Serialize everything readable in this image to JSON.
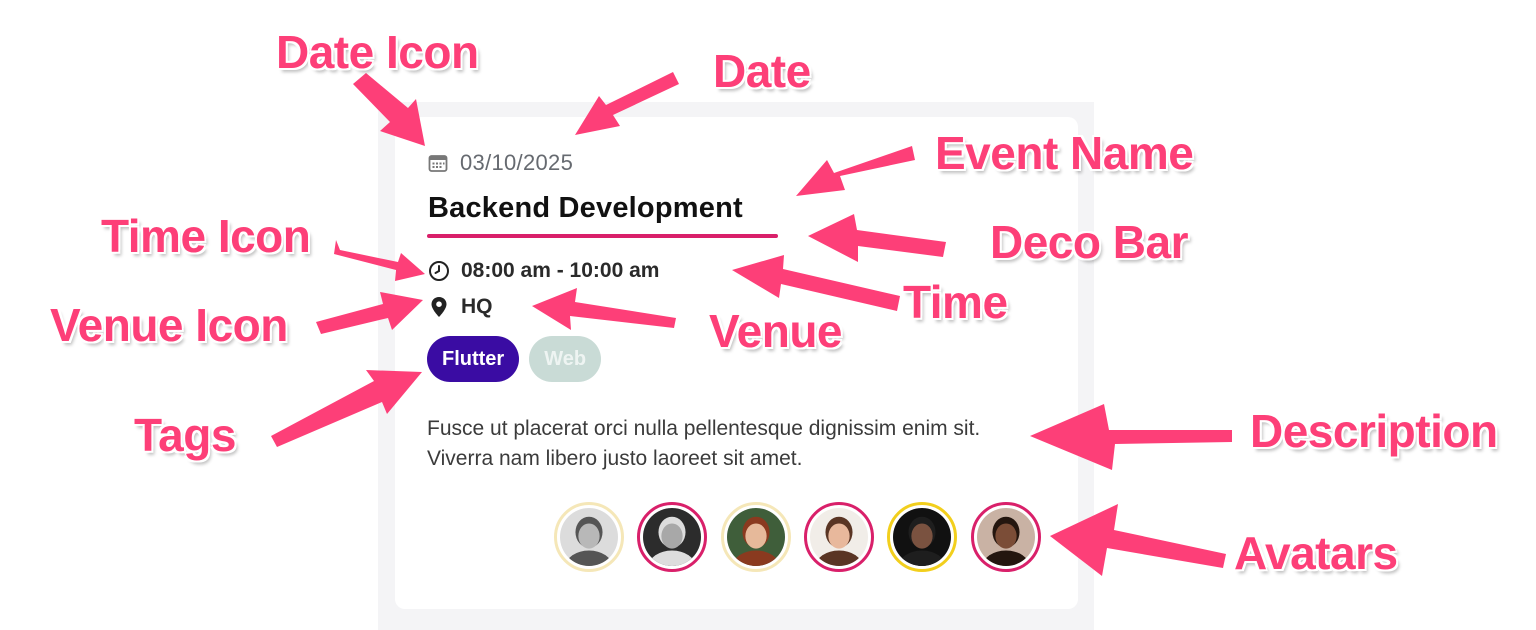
{
  "card": {
    "date": "03/10/2025",
    "event_name": "Backend Development",
    "time": "08:00 am - 10:00 am",
    "venue": "HQ",
    "tags": [
      {
        "label": "Flutter",
        "color": "#3a0ca3",
        "active": true
      },
      {
        "label": "Web",
        "color": "#c9dbd6",
        "active": false
      }
    ],
    "description": "Fusce ut placerat orci nulla pellentesque dignissim enim sit. Viverra nam libero justo laoreet sit amet.",
    "deco_bar_color": "#d9206a",
    "avatars": [
      {
        "ring_color": "#f5e7b8",
        "skin": "#b8b8b8",
        "hair": "#555555",
        "bg": "#dcdcdc"
      },
      {
        "ring_color": "#d9206a",
        "skin": "#a8a8a8",
        "hair": "#dddddd",
        "bg": "#2c2c2c"
      },
      {
        "ring_color": "#f5e7b8",
        "skin": "#e6b99a",
        "hair": "#8a3a1f",
        "bg": "#3f5e3a"
      },
      {
        "ring_color": "#d9206a",
        "skin": "#e8b89c",
        "hair": "#5a3524",
        "bg": "#f1ede8"
      },
      {
        "ring_color": "#f2cf1d",
        "skin": "#7a5240",
        "hair": "#1e1e1e",
        "bg": "#111111"
      },
      {
        "ring_color": "#d9206a",
        "skin": "#7b4d37",
        "hair": "#24160f",
        "bg": "#c9b2a4"
      }
    ]
  },
  "icons": {
    "date": "calendar-icon",
    "time": "clock-icon",
    "venue": "map-pin-icon"
  },
  "annotations": {
    "date_icon": "Date Icon",
    "date": "Date",
    "event_name": "Event Name",
    "deco_bar": "Deco Bar",
    "time_icon": "Time Icon",
    "time": "Time",
    "venue_icon": "Venue Icon",
    "venue": "Venue",
    "tags": "Tags",
    "description": "Description",
    "avatars": "Avatars",
    "color": "#fd3f78"
  }
}
